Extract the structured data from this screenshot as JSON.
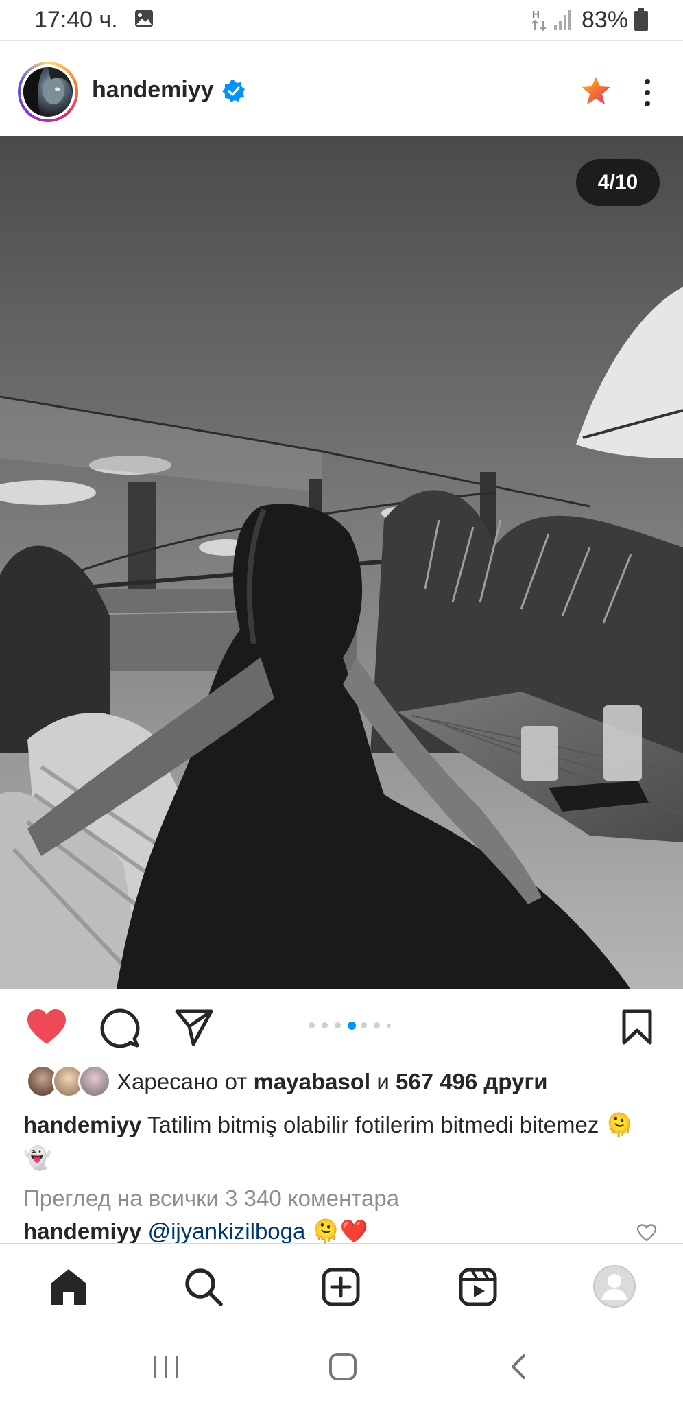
{
  "status_bar": {
    "time": "17:40 ч.",
    "network": "H",
    "battery": "83%"
  },
  "post": {
    "username": "handemiyy",
    "counter": "4/10",
    "carousel": {
      "total": 7,
      "active": 3
    },
    "likes": {
      "prefix": "Харесано от",
      "user": "mayabasol",
      "connector": "и",
      "count": "567 496 други"
    },
    "caption": {
      "username": "handemiyy",
      "text": "Tatilim bitmiş olabilir fotilerim bitmedi bitemez 🫠👻"
    },
    "view_comments": "Преглед на всички 3 340 коментара",
    "comment": {
      "username": "handemiyy",
      "mention": "@ijyankizilboga",
      "emoji": "🫠❤️"
    }
  },
  "colors": {
    "like_red": "#ed4956",
    "verified_blue": "#0095f6",
    "active_dot": "#0095f6",
    "text": "#262626",
    "secondary": "#8e8e8e"
  },
  "icons": {
    "like": "heart-filled-icon",
    "comment": "comment-bubble-icon",
    "share": "paper-plane-icon",
    "save": "bookmark-icon",
    "home": "home-icon",
    "search": "search-icon",
    "create": "plus-square-icon",
    "reels": "reels-icon",
    "profile": "profile-icon"
  }
}
